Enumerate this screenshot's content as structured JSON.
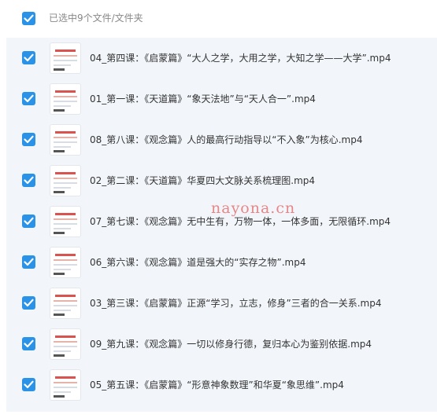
{
  "header": {
    "label": "已选中9个文件/文件夹",
    "checked": true
  },
  "accent": "#2a93e8",
  "files": [
    {
      "name": "04_第四课：《启蒙篇》“大人之学，大用之学，大知之学——大学”.mp4",
      "checked": true
    },
    {
      "name": "01_第一课：《天道篇》“象天法地”与“天人合一”.mp4",
      "checked": true
    },
    {
      "name": "08_第八课：《观念篇》人的最高行动指导以“不入象”为核心.mp4",
      "checked": true
    },
    {
      "name": "02_第二课：《天道篇》华夏四大文脉关系梳理图.mp4",
      "checked": true
    },
    {
      "name": "07_第七课：《观念篇》无中生有，万物一体，一体多面，无限循环.mp4",
      "checked": true
    },
    {
      "name": "06_第六课：《观念篇》道是强大的“实存之物”.mp4",
      "checked": true
    },
    {
      "name": "03_第三课：《启蒙篇》正源“学习，立志，修身”三者的合一关系.mp4",
      "checked": true
    },
    {
      "name": "09_第九课：《观念篇》一切以修身行德，复归本心为鉴别依据.mp4",
      "checked": true
    },
    {
      "name": "05_第五课：《启蒙篇》“形意神象数理”和华夏“象思维”.mp4",
      "checked": true
    }
  ],
  "watermark": "nayona.cn"
}
